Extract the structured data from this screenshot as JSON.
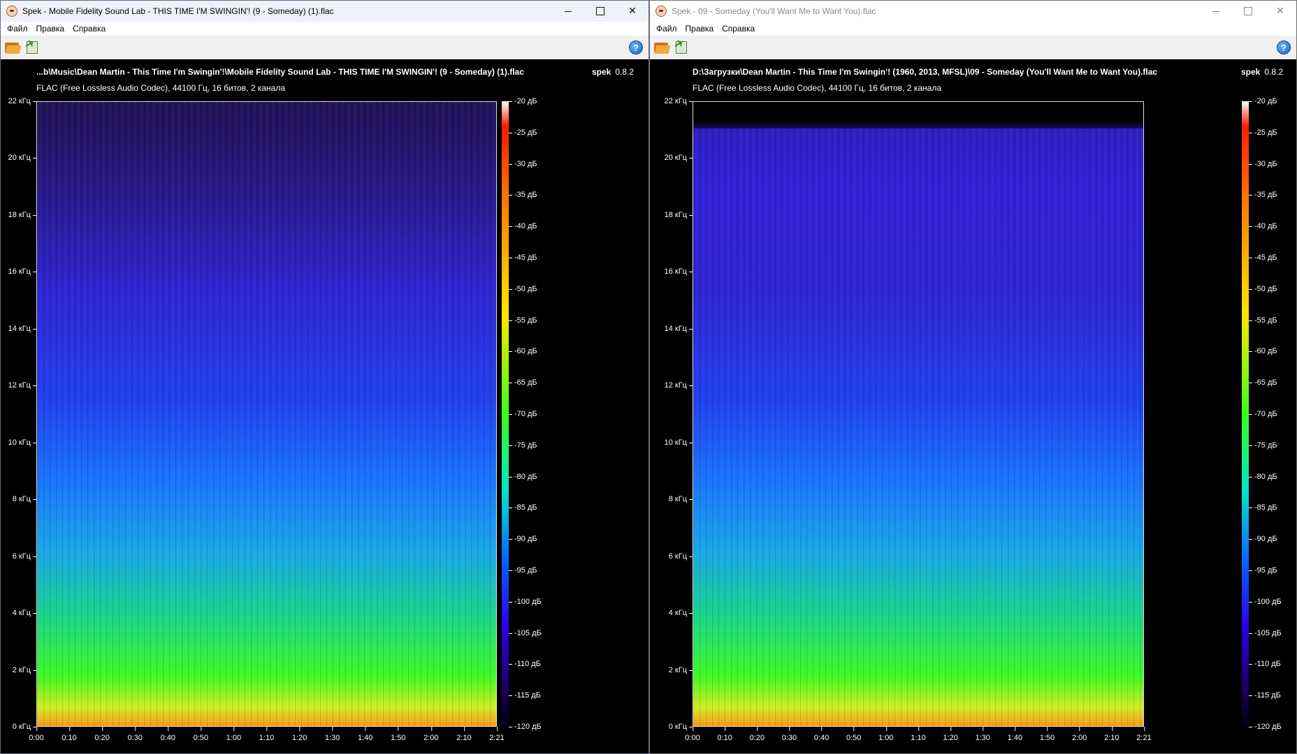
{
  "colors": {
    "background": "#000000",
    "spectrum_low": "#1a0b55",
    "spectrum_mid": "#1b2cf2",
    "spectrum_high": "#3cff1a",
    "spectrum_peak": "#ffe600"
  },
  "frequency_ticks": [
    "22 кГц",
    "20 кГц",
    "18 кГц",
    "16 кГц",
    "14 кГц",
    "12 кГц",
    "10 кГц",
    "8 кГц",
    "6 кГц",
    "4 кГц",
    "2 кГц",
    "0 кГц"
  ],
  "time_ticks": [
    "0:00",
    "0:10",
    "0:20",
    "0:30",
    "0:40",
    "0:50",
    "1:00",
    "1:10",
    "1:20",
    "1:30",
    "1:40",
    "1:50",
    "2:00",
    "2:10",
    "2:21"
  ],
  "db_ticks": [
    "-20 дБ",
    "-25 дБ",
    "-30 дБ",
    "-35 дБ",
    "-40 дБ",
    "-45 дБ",
    "-50 дБ",
    "-55 дБ",
    "-60 дБ",
    "-65 дБ",
    "-70 дБ",
    "-75 дБ",
    "-80 дБ",
    "-85 дБ",
    "-90 дБ",
    "-95 дБ",
    "-100 дБ",
    "-105 дБ",
    "-110 дБ",
    "-115 дБ",
    "-120 дБ"
  ],
  "windows": [
    {
      "title": "Spek - Mobile Fidelity Sound Lab - THIS TIME I'M SWINGIN'! (9 - Someday) (1).flac",
      "menu": [
        "Файл",
        "Правка",
        "Справка"
      ],
      "file_path": "...b\\Music\\Dean Martin - This Time I'm Swingin'!\\Mobile Fidelity Sound Lab - THIS TIME I'M SWINGIN'! (9 - Someday) (1).flac",
      "codec_info": "FLAC (Free Lossless Audio Codec), 44100 Гц, 16 битов, 2 канала",
      "brand": "spek",
      "version": "0.8.2",
      "help_label": "?",
      "high_frequency_cutoff": false
    },
    {
      "title": "Spek - 09 - Someday (You'll Want Me to Want You).flac",
      "menu": [
        "Файл",
        "Правка",
        "Справка"
      ],
      "file_path": "D:\\Загрузки\\Dean Martin - This Time I'm Swingin'! (1960, 2013, MFSL)\\09 - Someday (You'll Want Me to Want You).flac",
      "codec_info": "FLAC (Free Lossless Audio Codec), 44100 Гц, 16 битов, 2 канала",
      "brand": "spek",
      "version": "0.8.2",
      "help_label": "?",
      "high_frequency_cutoff": true
    }
  ]
}
